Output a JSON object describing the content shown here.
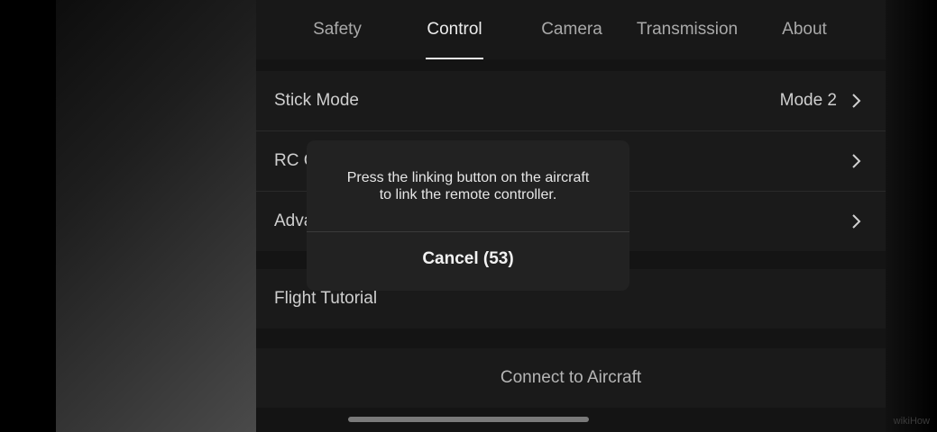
{
  "tabs": [
    {
      "label": "Safety",
      "active": false
    },
    {
      "label": "Control",
      "active": true
    },
    {
      "label": "Camera",
      "active": false
    },
    {
      "label": "Transmission",
      "active": false
    },
    {
      "label": "About",
      "active": false
    }
  ],
  "settings": {
    "stick_mode": {
      "label": "Stick Mode",
      "value": "Mode 2"
    },
    "rc_row": {
      "label": "RC C"
    },
    "advanced_row": {
      "label": "Adva"
    },
    "flight_tutorial": {
      "label": "Flight Tutorial"
    }
  },
  "connect_button": {
    "label": "Connect to Aircraft"
  },
  "dialog": {
    "message_line1": "Press the linking button on the aircraft",
    "message_line2": "to link the remote controller.",
    "cancel_label": "Cancel (53)"
  },
  "watermark": "wikiHow",
  "colors": {
    "panel_bg": "#141414",
    "row_bg": "#1a1a1a",
    "dialog_bg": "#222222",
    "text_primary": "#ececec",
    "text_secondary": "#a9a9a9"
  },
  "icons": {
    "row_chevron": "chevron-right-icon"
  }
}
